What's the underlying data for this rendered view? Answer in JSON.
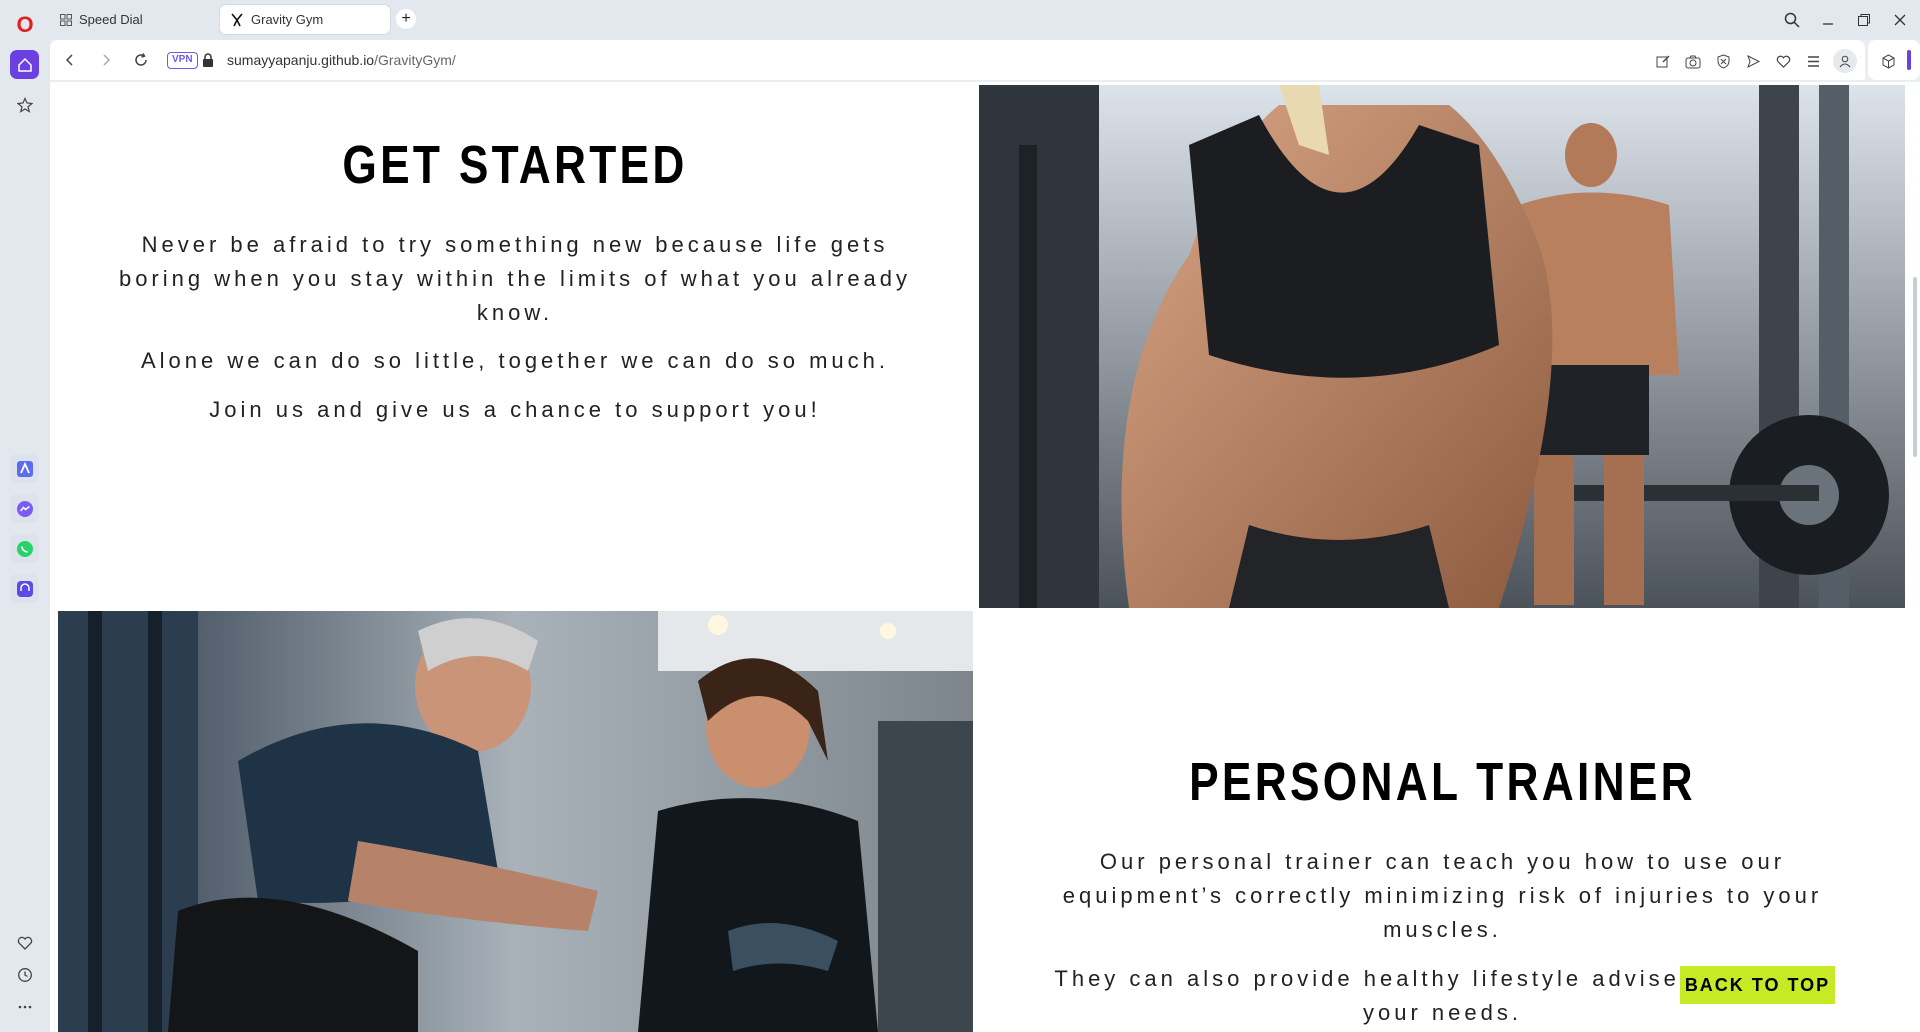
{
  "browser": {
    "tabs": [
      {
        "label": "Speed Dial",
        "active": false
      },
      {
        "label": "Gravity Gym",
        "active": true
      }
    ],
    "new_tab_symbol": "+",
    "vpn_label": "VPN",
    "url_domain": "sumayyapanju.github.io",
    "url_path": "/GravityGym/",
    "accent_color": "#6c5ce7",
    "logo_color": "#e0221f"
  },
  "sidebar": {
    "items": [
      {
        "icon": "home-icon"
      },
      {
        "icon": "star-icon"
      },
      {
        "icon": "aria-icon"
      },
      {
        "icon": "messenger-icon"
      },
      {
        "icon": "whatsapp-icon"
      },
      {
        "icon": "music-player-icon"
      },
      {
        "icon": "heart-icon"
      },
      {
        "icon": "history-icon"
      },
      {
        "icon": "more-icon"
      }
    ]
  },
  "page": {
    "get_started": {
      "title": "GET STARTED",
      "paragraphs": [
        "Never be afraid to try something new because life gets boring when you stay within the limits of what you already know.",
        "Alone we can do so little, together we can do so much.",
        "Join us and give us a chance to support you!"
      ]
    },
    "personal_trainer": {
      "title": "PERSONAL TRAINER",
      "paragraphs": [
        "Our personal trainer can teach you how to use our equipment’s correctly minimizing risk of injuries to your muscles.",
        "They can also provide healthy lifestyle advise tailored to your needs."
      ]
    },
    "back_to_top": "BACK TO TOP",
    "back_to_top_color": "#c6ea26"
  }
}
